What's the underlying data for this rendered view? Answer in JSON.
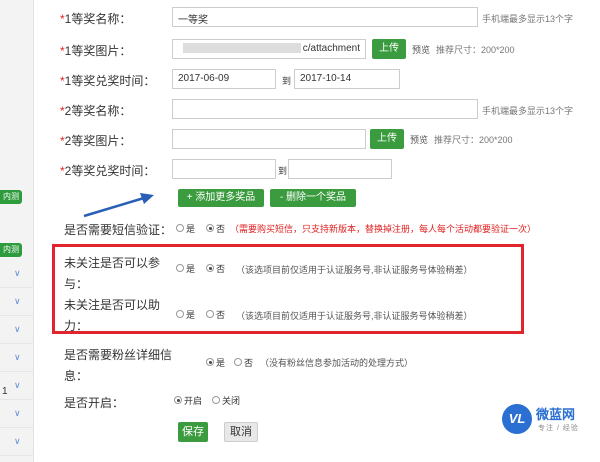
{
  "sidebar": {
    "badges": [
      "内测",
      "内测"
    ],
    "number": "1"
  },
  "prize1": {
    "name_label": "1等奖名称：",
    "name_value": "一等奖",
    "name_hint": "手机端最多显示13个字",
    "image_label": "1等奖图片：",
    "image_value": "c/attachment",
    "upload_label": "上传",
    "preview_label": "预览",
    "image_hint": "推荐尺寸：200*200",
    "time_label": "1等奖兑奖时间：",
    "time_start": "2017-06-09",
    "time_to": "到",
    "time_end": "2017-10-14"
  },
  "prize2": {
    "name_label": "2等奖名称：",
    "name_value": "",
    "name_hint": "手机端最多显示13个字",
    "image_label": "2等奖图片：",
    "image_value": "",
    "upload_label": "上传",
    "preview_label": "预览",
    "image_hint": "推荐尺寸：200*200",
    "time_label": "2等奖兑奖时间：",
    "time_start": "",
    "time_to": "到",
    "time_end": ""
  },
  "prize_actions": {
    "add_label": "+ 添加更多奖品",
    "remove_label": "- 删除一个奖品"
  },
  "sms": {
    "label": "是否需要短信验证：",
    "yes": "是",
    "no": "否",
    "selected": "否",
    "note": "（需要购买短信，只支持新版本，替换掉注册，每人每个活动都要验证一次）"
  },
  "unfollow_join": {
    "label_line1": "未关注是否可以参",
    "label_line2": "与：",
    "yes": "是",
    "no": "否",
    "selected": "否",
    "note": "（该选项目前仅适用于认证服务号,非认证服务号体验稍差）"
  },
  "unfollow_help": {
    "label_line1": "未关注是否可以助",
    "label_line2": "力：",
    "yes": "是",
    "no": "否",
    "selected": "否",
    "note": "（该选项目前仅适用于认证服务号,非认证服务号体验稍差）"
  },
  "fan_info": {
    "label_line1": "是否需要粉丝详细信",
    "label_line2": "息：",
    "yes": "是",
    "no": "否",
    "selected": "是",
    "note": "（没有粉丝信息参加活动的处理方式）"
  },
  "enable": {
    "label": "是否开启：",
    "on": "开启",
    "off": "关闭",
    "selected": "开启"
  },
  "footer": {
    "save_label": "保存",
    "cancel_label": "取消"
  },
  "logo": {
    "mark": "VL",
    "name": "微蓝网",
    "sub": "专注 / 经验"
  },
  "colors": {
    "accent_green": "#3b9b3f",
    "highlight_red": "#e0252f",
    "required_red": "#e02020",
    "brand_blue": "#2a6fd1"
  }
}
